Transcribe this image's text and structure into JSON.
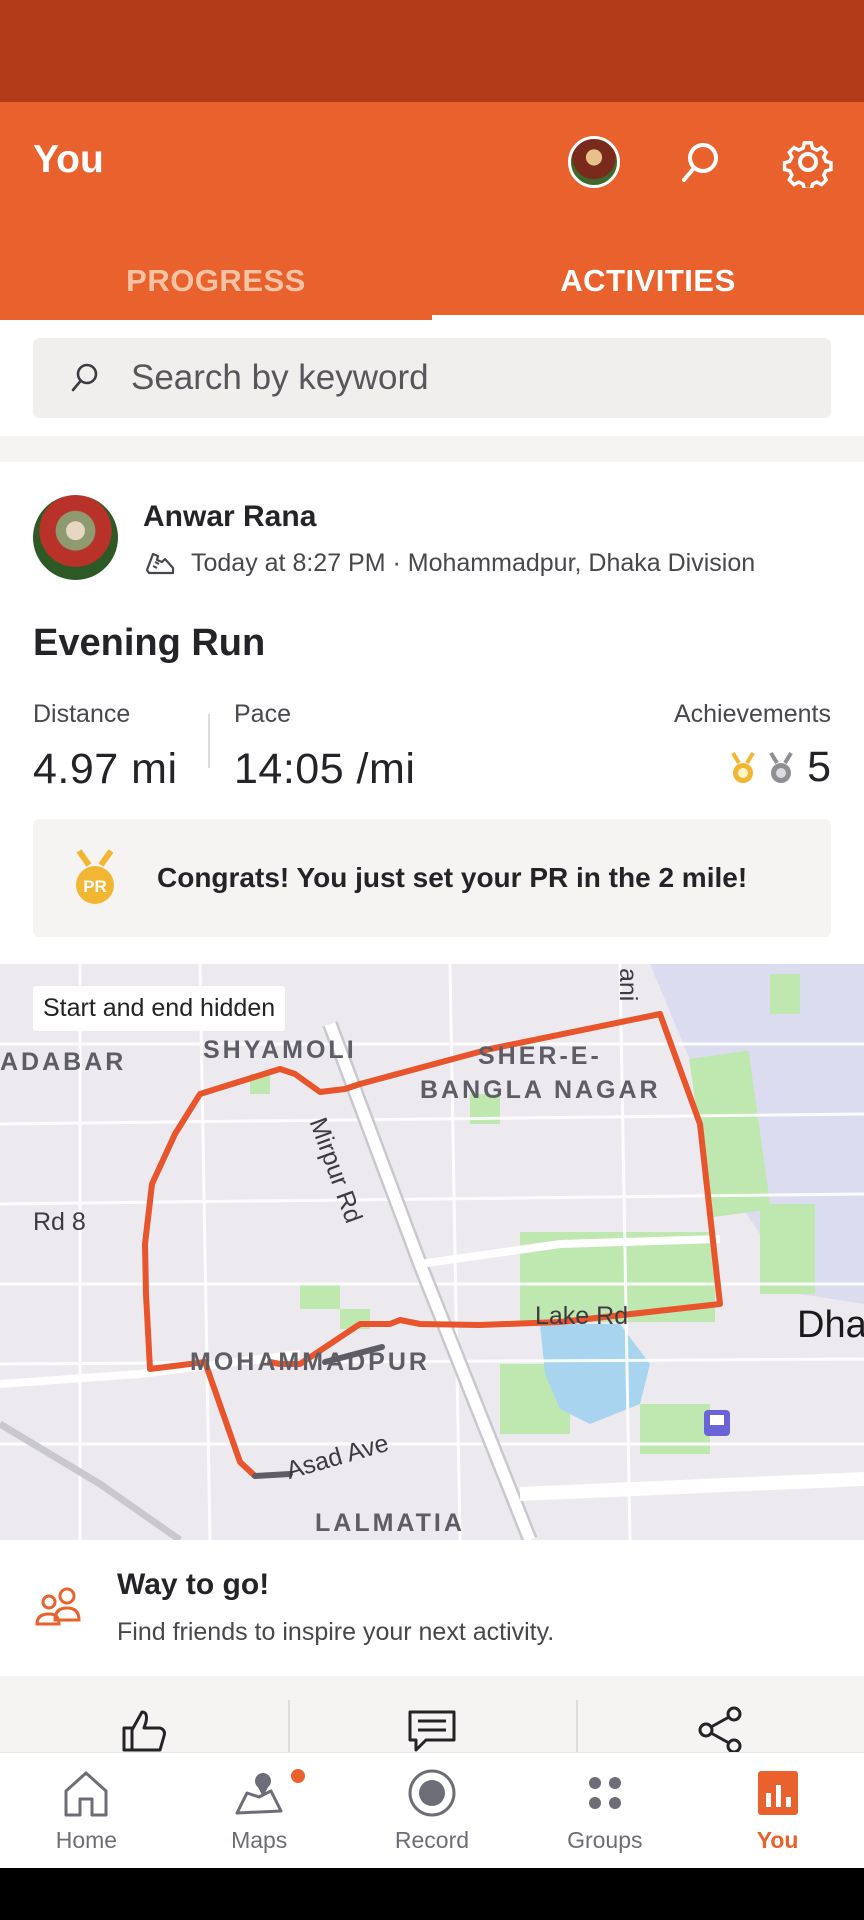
{
  "header": {
    "title": "You",
    "tabs": [
      {
        "label": "PROGRESS",
        "active": false
      },
      {
        "label": "ACTIVITIES",
        "active": true
      }
    ]
  },
  "search": {
    "placeholder": "Search by keyword"
  },
  "activity": {
    "athlete_name": "Anwar Rana",
    "meta": "Today at 8:27 PM · Mohammadpur, Dhaka Division",
    "title": "Evening Run",
    "stats": {
      "distance_label": "Distance",
      "distance_value": "4.97 mi",
      "pace_label": "Pace",
      "pace_value": "14:05 /mi",
      "achievements_label": "Achievements",
      "achievements_count": "5"
    },
    "pr_message": "Congrats! You just set your PR in the 2 mile!",
    "pr_icon_text": "PR"
  },
  "map": {
    "badge": "Start and end hidden",
    "labels": {
      "adabar": "ADABAR",
      "shyamoli": "SHYAMOLI",
      "sher_e": "SHER-E-",
      "bangla_nagar": "BANGLA NAGAR",
      "mirpur_rd": "Mirpur Rd",
      "rd8": "Rd 8",
      "mohammadpur": "MOHAMMADPUR",
      "lake_rd": "Lake Rd",
      "asad_ave": "Asad Ave",
      "lalmatia": "LALMATIA",
      "dha": "Dha",
      "ani": "ani"
    },
    "route_color": "#e8542b"
  },
  "social": {
    "title": "Way to go!",
    "subtitle": "Find friends to inspire your next activity."
  },
  "nav": {
    "items": [
      {
        "label": "Home",
        "icon": "home-icon"
      },
      {
        "label": "Maps",
        "icon": "maps-icon"
      },
      {
        "label": "Record",
        "icon": "record-icon"
      },
      {
        "label": "Groups",
        "icon": "groups-icon"
      },
      {
        "label": "You",
        "icon": "you-icon"
      }
    ]
  },
  "colors": {
    "brand": "#e9622d",
    "status_bar": "#b23b1a"
  }
}
